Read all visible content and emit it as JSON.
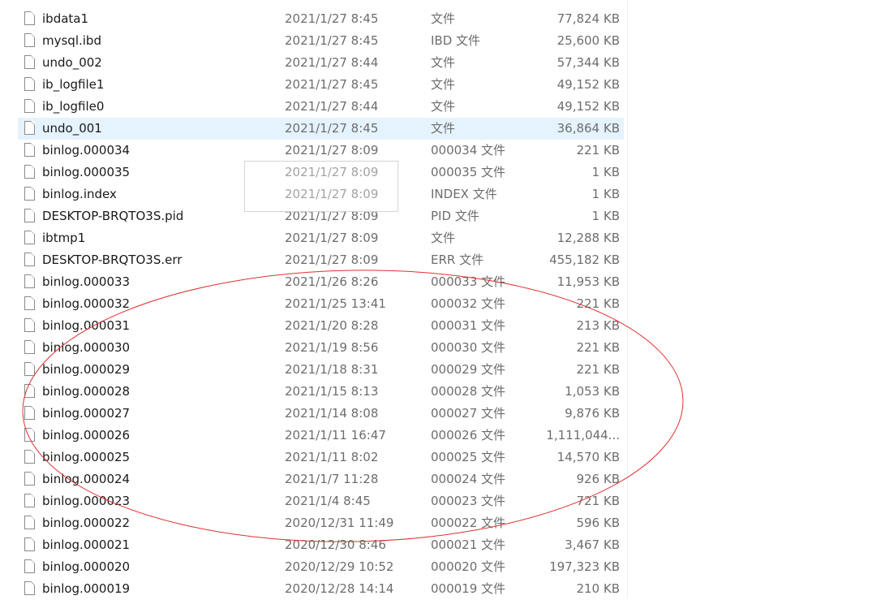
{
  "files": [
    {
      "name": "ibdata1",
      "date": "2021/1/27 8:45",
      "type": "文件",
      "size": "77,824 KB"
    },
    {
      "name": "mysql.ibd",
      "date": "2021/1/27 8:45",
      "type": "IBD 文件",
      "size": "25,600 KB"
    },
    {
      "name": "undo_002",
      "date": "2021/1/27 8:44",
      "type": "文件",
      "size": "57,344 KB"
    },
    {
      "name": "ib_logfile1",
      "date": "2021/1/27 8:45",
      "type": "文件",
      "size": "49,152 KB"
    },
    {
      "name": "ib_logfile0",
      "date": "2021/1/27 8:44",
      "type": "文件",
      "size": "49,152 KB"
    },
    {
      "name": "undo_001",
      "date": "2021/1/27 8:45",
      "type": "文件",
      "size": "36,864 KB"
    },
    {
      "name": "binlog.000034",
      "date": "2021/1/27 8:09",
      "type": "000034 文件",
      "size": "221 KB"
    },
    {
      "name": "binlog.000035",
      "date": "2021/1/27 8:09",
      "type": "000035 文件",
      "size": "1 KB"
    },
    {
      "name": "binlog.index",
      "date": "2021/1/27 8:09",
      "type": "INDEX 文件",
      "size": "1 KB"
    },
    {
      "name": "DESKTOP-BRQTO3S.pid",
      "date": "2021/1/27 8:09",
      "type": "PID 文件",
      "size": "1 KB"
    },
    {
      "name": "ibtmp1",
      "date": "2021/1/27 8:09",
      "type": "文件",
      "size": "12,288 KB"
    },
    {
      "name": "DESKTOP-BRQTO3S.err",
      "date": "2021/1/27 8:09",
      "type": "ERR 文件",
      "size": "455,182 KB"
    },
    {
      "name": "binlog.000033",
      "date": "2021/1/26 8:26",
      "type": "000033 文件",
      "size": "11,953 KB"
    },
    {
      "name": "binlog.000032",
      "date": "2021/1/25 13:41",
      "type": "000032 文件",
      "size": "221 KB"
    },
    {
      "name": "binlog.000031",
      "date": "2021/1/20 8:28",
      "type": "000031 文件",
      "size": "213 KB"
    },
    {
      "name": "binlog.000030",
      "date": "2021/1/19 8:56",
      "type": "000030 文件",
      "size": "221 KB"
    },
    {
      "name": "binlog.000029",
      "date": "2021/1/18 8:31",
      "type": "000029 文件",
      "size": "221 KB"
    },
    {
      "name": "binlog.000028",
      "date": "2021/1/15 8:13",
      "type": "000028 文件",
      "size": "1,053 KB"
    },
    {
      "name": "binlog.000027",
      "date": "2021/1/14 8:08",
      "type": "000027 文件",
      "size": "9,876 KB"
    },
    {
      "name": "binlog.000026",
      "date": "2021/1/11 16:47",
      "type": "000026 文件",
      "size": "1,111,044..."
    },
    {
      "name": "binlog.000025",
      "date": "2021/1/11 8:02",
      "type": "000025 文件",
      "size": "14,570 KB"
    },
    {
      "name": "binlog.000024",
      "date": "2021/1/7 11:28",
      "type": "000024 文件",
      "size": "926 KB"
    },
    {
      "name": "binlog.000023",
      "date": "2021/1/4 8:45",
      "type": "000023 文件",
      "size": "721 KB"
    },
    {
      "name": "binlog.000022",
      "date": "2020/12/31 11:49",
      "type": "000022 文件",
      "size": "596 KB"
    },
    {
      "name": "binlog.000021",
      "date": "2020/12/30 8:46",
      "type": "000021 文件",
      "size": "3,467 KB"
    },
    {
      "name": "binlog.000020",
      "date": "2020/12/29 10:52",
      "type": "000020 文件",
      "size": "197,323 KB"
    },
    {
      "name": "binlog.000019",
      "date": "2020/12/28 14:14",
      "type": "000019 文件",
      "size": "210 KB"
    }
  ],
  "selected_name": "undo_001",
  "annotation_color": "#e03030",
  "selection_color": "#e5f3ff",
  "icon_name": "file-icon"
}
